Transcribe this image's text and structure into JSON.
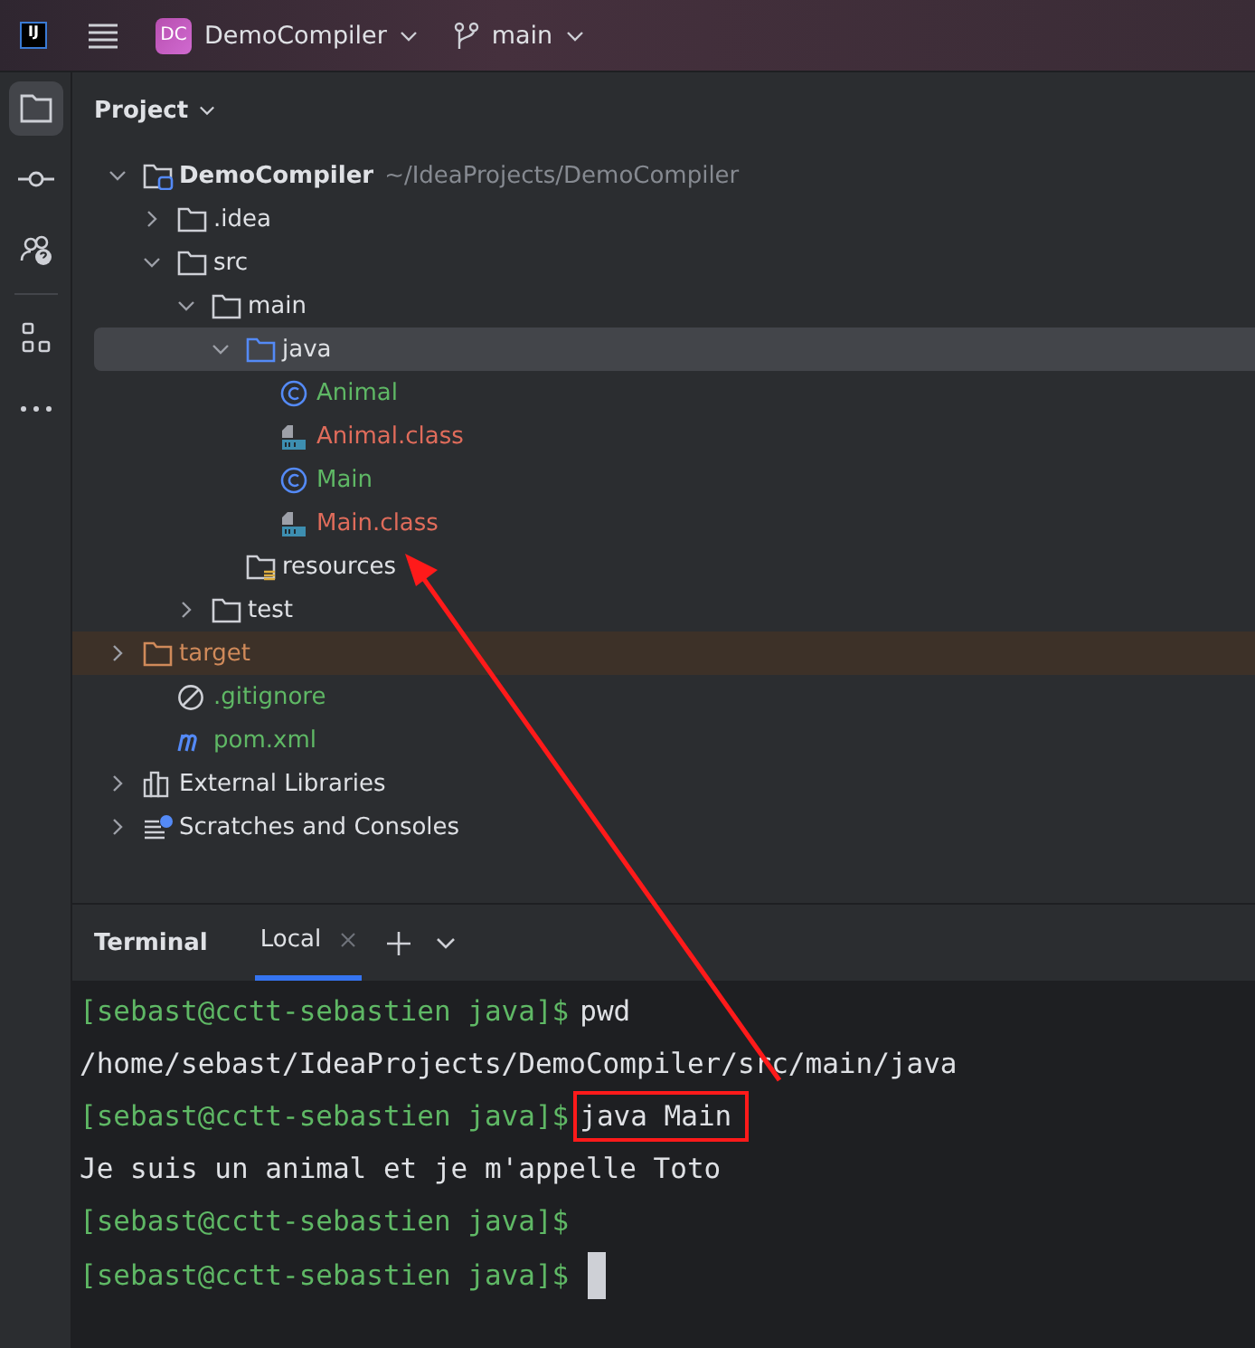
{
  "header": {
    "logo": "IJ",
    "project_badge": "DC",
    "project": "DemoCompiler",
    "branch": "main"
  },
  "sidebar": {
    "items": [
      {
        "kind": "folder",
        "selected": true
      },
      {
        "kind": "commit",
        "selected": false
      },
      {
        "kind": "help",
        "selected": false
      },
      {
        "kind": "structure",
        "selected": false
      },
      {
        "kind": "more",
        "selected": false
      }
    ]
  },
  "project_panel": {
    "title": "Project",
    "tree": [
      {
        "name": "DemoCompiler",
        "path": "~/IdeaProjects/DemoCompiler",
        "kind": "project",
        "expanded": true,
        "selected": false,
        "color": "#dfe1e5",
        "children": [
          {
            "name": ".idea",
            "kind": "folder",
            "expanded": false,
            "selected": false,
            "color": "#dfe1e5"
          },
          {
            "name": "src",
            "kind": "folder",
            "expanded": true,
            "selected": false,
            "color": "#dfe1e5",
            "children": [
              {
                "name": "main",
                "kind": "folder",
                "expanded": true,
                "selected": false,
                "color": "#dfe1e5",
                "children": [
                  {
                    "name": "java",
                    "kind": "source-folder",
                    "expanded": true,
                    "selected": true,
                    "color": "#dfe1e5",
                    "children": [
                      {
                        "name": "Animal",
                        "kind": "class",
                        "selected": false,
                        "color": "#5fb865"
                      },
                      {
                        "name": "Animal.class",
                        "kind": "classfile",
                        "selected": false,
                        "color": "#e06c5b"
                      },
                      {
                        "name": "Main",
                        "kind": "class",
                        "selected": false,
                        "color": "#5fb865"
                      },
                      {
                        "name": "Main.class",
                        "kind": "classfile",
                        "selected": false,
                        "color": "#e06c5b"
                      }
                    ]
                  },
                  {
                    "name": "resources",
                    "kind": "resources-folder",
                    "selected": false,
                    "color": "#dfe1e5"
                  }
                ]
              },
              {
                "name": "test",
                "kind": "folder",
                "expanded": false,
                "selected": false,
                "color": "#dfe1e5"
              }
            ]
          },
          {
            "name": "target",
            "kind": "excluded-folder",
            "expanded": false,
            "selected": false,
            "color": "#d08a5a"
          },
          {
            "name": ".gitignore",
            "kind": "gitignore",
            "selected": false,
            "color": "#5fb865"
          },
          {
            "name": "pom.xml",
            "kind": "maven",
            "selected": false,
            "color": "#5fb865"
          }
        ]
      },
      {
        "name": "External Libraries",
        "kind": "libraries",
        "expanded": false,
        "selected": false,
        "color": "#dfe1e5"
      },
      {
        "name": "Scratches and Consoles",
        "kind": "scratches",
        "expanded": false,
        "selected": false,
        "color": "#dfe1e5"
      }
    ]
  },
  "terminal": {
    "title": "Terminal",
    "tabs": [
      {
        "label": "Local",
        "selected": true
      }
    ],
    "lines": [
      {
        "prompt": "[sebast@cctt-sebastien java]$",
        "command": "pwd"
      },
      {
        "output": "/home/sebast/IdeaProjects/DemoCompiler/src/main/java"
      },
      {
        "prompt": "[sebast@cctt-sebastien java]$",
        "command": "java Main",
        "highlighted": true
      },
      {
        "output": "Je suis un animal et je m'appelle Toto"
      },
      {
        "prompt": "[sebast@cctt-sebastien java]$"
      },
      {
        "prompt": "[sebast@cctt-sebastien java]$",
        "cursor": true
      }
    ]
  },
  "annotation": {
    "kind": "arrow"
  }
}
